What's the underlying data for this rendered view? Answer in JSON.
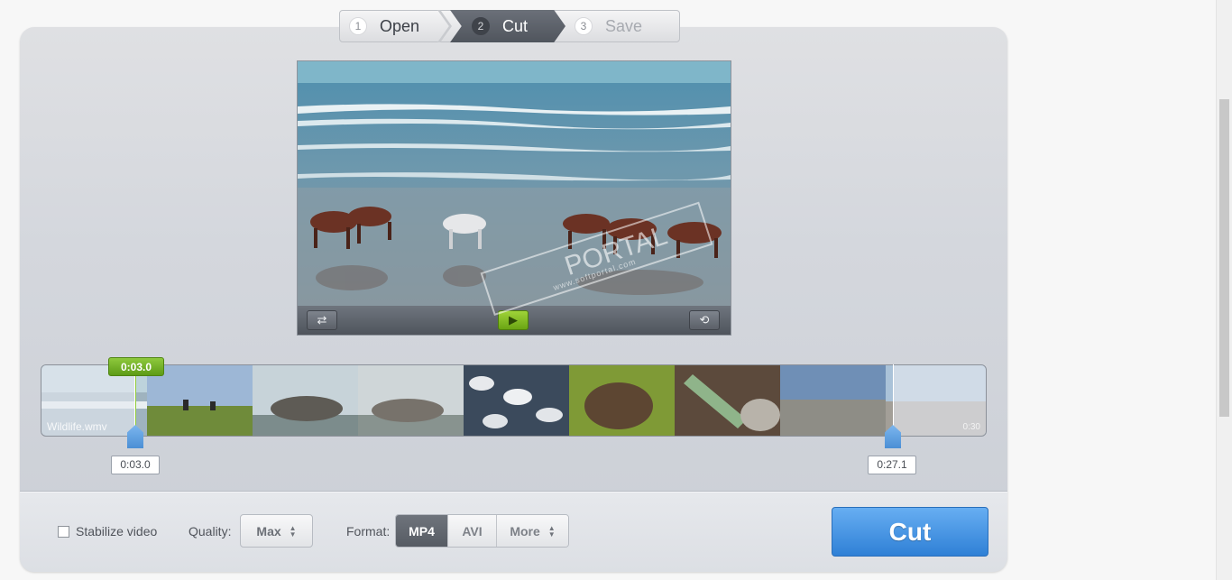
{
  "wizard": {
    "steps": [
      {
        "num": "1",
        "label": "Open",
        "state": "done"
      },
      {
        "num": "2",
        "label": "Cut",
        "state": "active"
      },
      {
        "num": "3",
        "label": "Save",
        "state": "disabled"
      }
    ]
  },
  "player": {
    "buttons": [
      {
        "name": "crop-rotate-button",
        "icon": "settings-icon"
      },
      {
        "name": "play-button",
        "icon": "play-icon"
      },
      {
        "name": "reset-button",
        "icon": "reset-icon"
      }
    ]
  },
  "watermark": {
    "text": "PORTAL",
    "sub": "www.softportal.com"
  },
  "timeline": {
    "filename": "Wildlife.wmv",
    "end_label": "0:30",
    "playhead": "0:03.0",
    "start_time": "0:03.0",
    "end_time": "0:27.1",
    "start_fraction": 0.1,
    "end_fraction": 0.903,
    "playhead_fraction": 0.1
  },
  "options": {
    "stabilize_label": "Stabilize video",
    "stabilize_checked": false,
    "quality_label": "Quality:",
    "quality_value": "Max",
    "format_label": "Format:",
    "formats": [
      "MP4",
      "AVI",
      "More"
    ],
    "active_format": "MP4"
  },
  "cut_button": "Cut",
  "colors": {
    "accent_blue": "#3f8fe0",
    "accent_green": "#7bbf2a",
    "panel": "#d4d7dd"
  }
}
